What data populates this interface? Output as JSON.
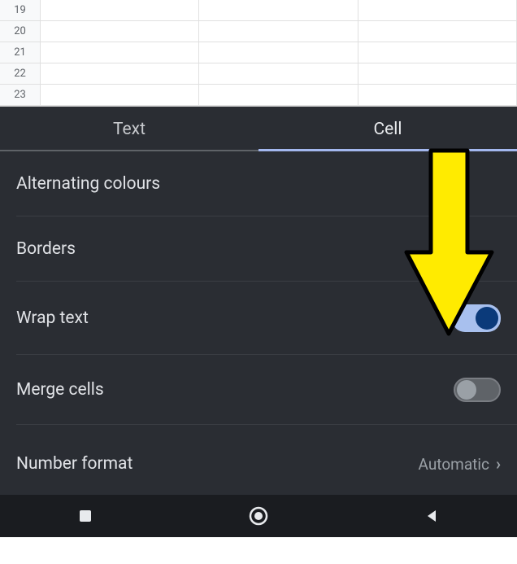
{
  "spreadsheet": {
    "visible_rows": [
      "19",
      "20",
      "21",
      "22",
      "23"
    ]
  },
  "panel": {
    "tabs": {
      "text": "Text",
      "cell": "Cell",
      "active": "cell"
    },
    "options": {
      "alternating_colours": "Alternating colours",
      "borders": "Borders",
      "wrap_text": "Wrap text",
      "wrap_text_on": true,
      "merge_cells": "Merge cells",
      "merge_cells_on": false,
      "number_format": "Number format",
      "number_format_value": "Automatic"
    }
  },
  "annotation": {
    "arrow_color": "#ffeb00",
    "arrow_stroke": "#000000"
  }
}
